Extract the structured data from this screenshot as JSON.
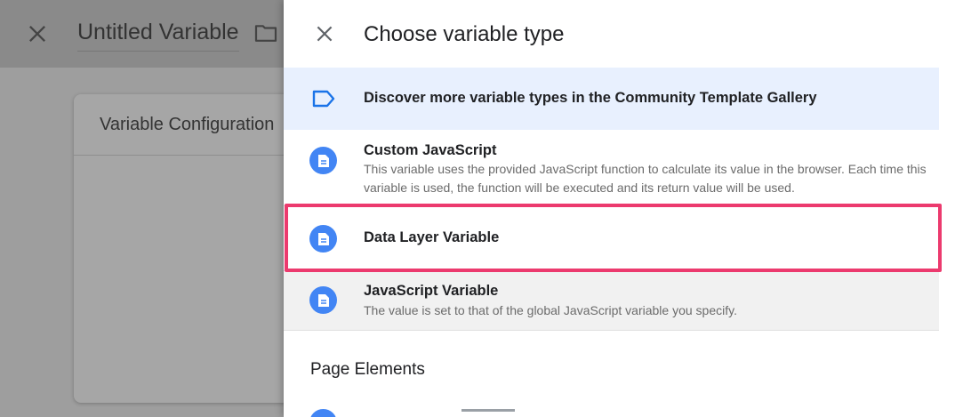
{
  "background": {
    "title": "Untitled Variable",
    "card_title": "Variable Configuration",
    "icons": [
      "close-icon",
      "folder-icon"
    ]
  },
  "panel": {
    "title": "Choose variable type",
    "gallery_link": "Discover more variable types in the Community Template Gallery",
    "items": [
      {
        "name": "Custom JavaScript",
        "description": "This variable uses the provided JavaScript function to calculate its value in the browser. Each time this variable is used, the function will be executed and its return value will be used."
      },
      {
        "name": "Data Layer Variable",
        "description": ""
      },
      {
        "name": "JavaScript Variable",
        "description": "The value is set to that of the global JavaScript variable you specify."
      }
    ],
    "section": "Page Elements"
  },
  "colors": {
    "accent": "#4285f4",
    "highlight": "#ec3a6e",
    "gallery_bg": "#e8f0fe"
  }
}
